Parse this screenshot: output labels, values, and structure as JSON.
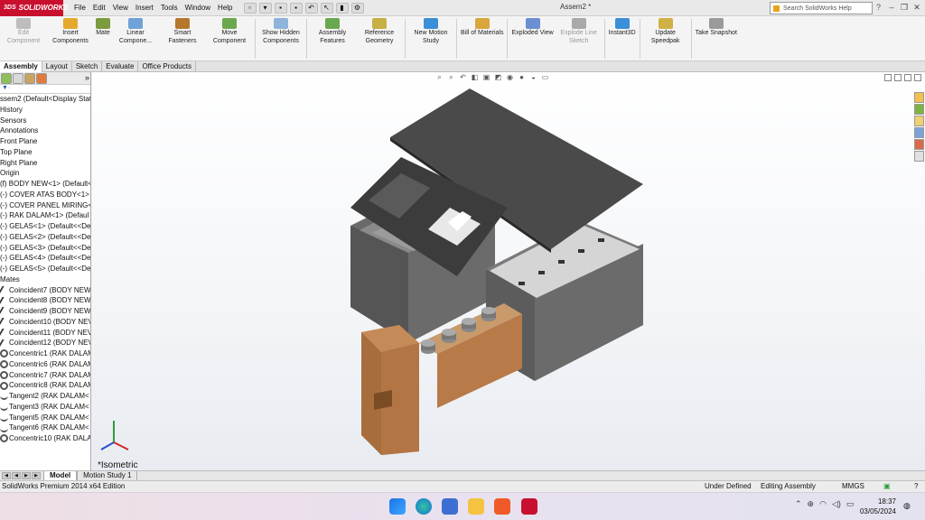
{
  "app": {
    "logo_text": "SOLIDWORKS",
    "logo_ds": "3DS",
    "title": "Assem2 *",
    "menu": [
      "File",
      "Edit",
      "View",
      "Insert",
      "Tools",
      "Window",
      "Help"
    ],
    "search_placeholder": "Search SolidWorks Help"
  },
  "ribbon": [
    {
      "label": "Edit Component",
      "disabled": true
    },
    {
      "label": "Insert Components"
    },
    {
      "label": "Mate"
    },
    {
      "label": "Linear Compone..."
    },
    {
      "label": "Smart Fasteners"
    },
    {
      "label": "Move Component"
    },
    {
      "label": "Show Hidden Components"
    },
    {
      "label": "Assembly Features"
    },
    {
      "label": "Reference Geometry"
    },
    {
      "label": "New Motion Study"
    },
    {
      "label": "Bill of Materials"
    },
    {
      "label": "Exploded View"
    },
    {
      "label": "Explode Line Sketch",
      "disabled": true
    },
    {
      "label": "Instant3D"
    },
    {
      "label": "Update Speedpak"
    },
    {
      "label": "Take Snapshot"
    }
  ],
  "command_tabs": [
    "Assembly",
    "Layout",
    "Sketch",
    "Evaluate",
    "Office Products"
  ],
  "tree": {
    "root": "ssem2  (Default<Display State",
    "items": [
      "History",
      "Sensors",
      "Annotations",
      "Front Plane",
      "Top Plane",
      "Right Plane",
      "Origin",
      "(f) BODY NEW<1> (Default<",
      "(-) COVER ATAS BODY<1> (",
      "(-) COVER PANEL MIRING<1",
      "(-) RAK DALAM<1> (Defaul",
      "(-) GELAS<1> (Default<<De",
      "(-) GELAS<2> (Default<<De",
      "(-) GELAS<3> (Default<<De",
      "(-) GELAS<4> (Default<<De",
      "(-) GELAS<5> (Default<<De",
      "Mates"
    ],
    "mates": [
      {
        "label": "Coincident7 (BODY NEW",
        "kind": "mate"
      },
      {
        "label": "Coincident8 (BODY NEW",
        "kind": "mate"
      },
      {
        "label": "Coincident9 (BODY NEW",
        "kind": "mate"
      },
      {
        "label": "Coincident10 (BODY NEV",
        "kind": "mate"
      },
      {
        "label": "Coincident11 (BODY NEV",
        "kind": "mate"
      },
      {
        "label": "Coincident12 (BODY NEV",
        "kind": "mate"
      },
      {
        "label": "Concentric1 (RAK DALAM",
        "kind": "ring"
      },
      {
        "label": "Concentric6 (RAK DALAM",
        "kind": "ring"
      },
      {
        "label": "Concentric7 (RAK DALAM",
        "kind": "ring"
      },
      {
        "label": "Concentric8 (RAK DALAM",
        "kind": "ring"
      },
      {
        "label": "Tangent2 (RAK DALAM<",
        "kind": "tan"
      },
      {
        "label": "Tangent3 (RAK DALAM<",
        "kind": "tan"
      },
      {
        "label": "Tangent5 (RAK DALAM<",
        "kind": "tan"
      },
      {
        "label": "Tangent6 (RAK DALAM<",
        "kind": "tan"
      },
      {
        "label": "Concentric10 (RAK DALAM",
        "kind": "ring"
      }
    ]
  },
  "bottom_tabs": [
    "Model",
    "Motion Study 1"
  ],
  "view_label": "*Isometric",
  "status": {
    "edition": "SolidWorks Premium 2014 x64 Edition",
    "defined": "Under Defined",
    "mode": "Editing Assembly",
    "units": "MMGS"
  },
  "clock": {
    "time": "18:37",
    "date": "03/05/2024"
  },
  "colors": {
    "logo": "#c8102e",
    "wood": "#b87a48",
    "body": "#595959",
    "cover": "#3a3a3a"
  }
}
